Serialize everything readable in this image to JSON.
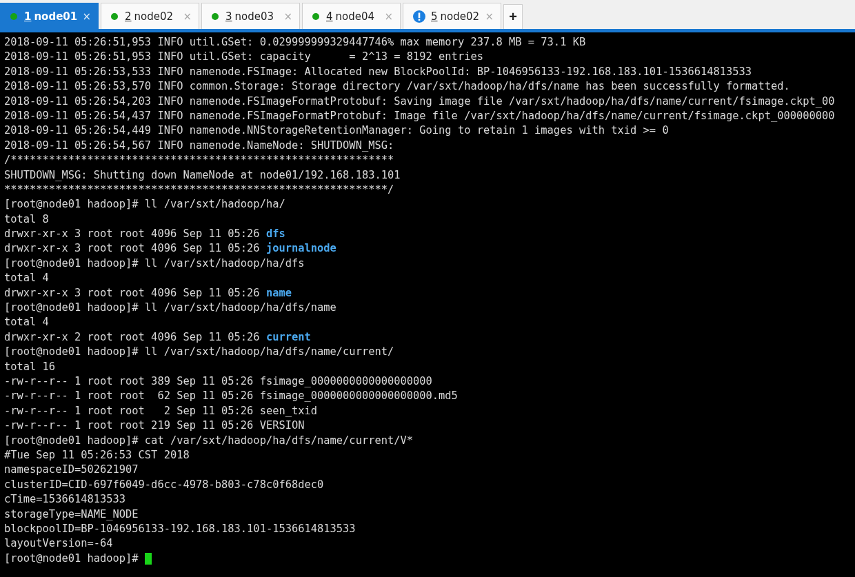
{
  "tabs": [
    {
      "number": "1",
      "label": "node01",
      "kind": "ok",
      "selected": true
    },
    {
      "number": "2",
      "label": "node02",
      "kind": "ok",
      "selected": false
    },
    {
      "number": "3",
      "label": "node03",
      "kind": "ok",
      "selected": false
    },
    {
      "number": "4",
      "label": "node04",
      "kind": "ok",
      "selected": false
    },
    {
      "number": "5",
      "label": "node02",
      "kind": "alert",
      "selected": false
    }
  ],
  "close_label": "×",
  "new_tab_label": "+",
  "terminal": {
    "lines": [
      {
        "text": "2018-09-11 05:26:51,953 INFO util.GSet: 0.029999999329447746% max memory 237.8 MB = 73.1 KB"
      },
      {
        "text": "2018-09-11 05:26:51,953 INFO util.GSet: capacity      = 2^13 = 8192 entries"
      },
      {
        "text": "2018-09-11 05:26:53,533 INFO namenode.FSImage: Allocated new BlockPoolId: BP-1046956133-192.168.183.101-1536614813533"
      },
      {
        "text": "2018-09-11 05:26:53,570 INFO common.Storage: Storage directory /var/sxt/hadoop/ha/dfs/name has been successfully formatted."
      },
      {
        "text": "2018-09-11 05:26:54,203 INFO namenode.FSImageFormatProtobuf: Saving image file /var/sxt/hadoop/ha/dfs/name/current/fsimage.ckpt_00"
      },
      {
        "text": "2018-09-11 05:26:54,437 INFO namenode.FSImageFormatProtobuf: Image file /var/sxt/hadoop/ha/dfs/name/current/fsimage.ckpt_000000000"
      },
      {
        "text": "2018-09-11 05:26:54,449 INFO namenode.NNStorageRetentionManager: Going to retain 1 images with txid >= 0"
      },
      {
        "text": "2018-09-11 05:26:54,567 INFO namenode.NameNode: SHUTDOWN_MSG:"
      },
      {
        "text": "/************************************************************"
      },
      {
        "text": "SHUTDOWN_MSG: Shutting down NameNode at node01/192.168.183.101"
      },
      {
        "text": "************************************************************/"
      },
      {
        "text": "[root@node01 hadoop]# ll /var/sxt/hadoop/ha/"
      },
      {
        "text": "total 8"
      },
      {
        "text": "drwxr-xr-x 3 root root 4096 Sep 11 05:26 ",
        "entry": "dfs",
        "kind": "directory"
      },
      {
        "text": "drwxr-xr-x 3 root root 4096 Sep 11 05:26 ",
        "entry": "journalnode",
        "kind": "directory"
      },
      {
        "text": "[root@node01 hadoop]# ll /var/sxt/hadoop/ha/dfs"
      },
      {
        "text": "total 4"
      },
      {
        "text": "drwxr-xr-x 3 root root 4096 Sep 11 05:26 ",
        "entry": "name",
        "kind": "directory"
      },
      {
        "text": "[root@node01 hadoop]# ll /var/sxt/hadoop/ha/dfs/name"
      },
      {
        "text": "total 4"
      },
      {
        "text": "drwxr-xr-x 2 root root 4096 Sep 11 05:26 ",
        "entry": "current",
        "kind": "directory"
      },
      {
        "text": "[root@node01 hadoop]# ll /var/sxt/hadoop/ha/dfs/name/current/"
      },
      {
        "text": "total 16"
      },
      {
        "text": "-rw-r--r-- 1 root root 389 Sep 11 05:26 ",
        "entry": "fsimage_0000000000000000000",
        "kind": "file"
      },
      {
        "text": "-rw-r--r-- 1 root root  62 Sep 11 05:26 ",
        "entry": "fsimage_0000000000000000000.md5",
        "kind": "file"
      },
      {
        "text": "-rw-r--r-- 1 root root   2 Sep 11 05:26 ",
        "entry": "seen_txid",
        "kind": "file"
      },
      {
        "text": "-rw-r--r-- 1 root root 219 Sep 11 05:26 ",
        "entry": "VERSION",
        "kind": "file"
      },
      {
        "text": "[root@node01 hadoop]# cat /var/sxt/hadoop/ha/dfs/name/current/V*"
      },
      {
        "text": "#Tue Sep 11 05:26:53 CST 2018"
      },
      {
        "text": "namespaceID=502621907"
      },
      {
        "text": "clusterID=CID-697f6049-d6cc-4978-b803-c78c0f68dec0"
      },
      {
        "text": "cTime=1536614813533"
      },
      {
        "text": "storageType=NAME_NODE"
      },
      {
        "text": "blockpoolID=BP-1046956133-192.168.183.101-1536614813533"
      },
      {
        "text": "layoutVersion=-64"
      }
    ],
    "prompt": "[root@node01 hadoop]# "
  }
}
